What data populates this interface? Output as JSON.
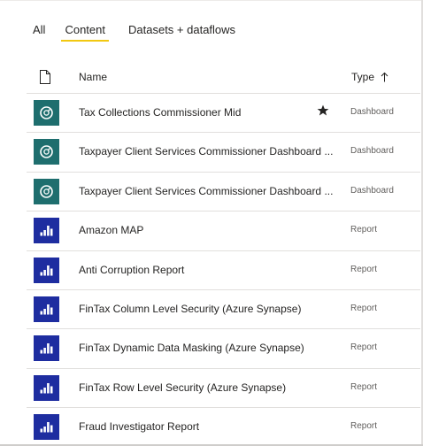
{
  "tabs": [
    {
      "label": "All",
      "active": false
    },
    {
      "label": "Content",
      "active": true
    },
    {
      "label": "Datasets + dataflows",
      "active": false
    }
  ],
  "columns": {
    "file_icon": "file-icon",
    "name": "Name",
    "type": "Type",
    "sort_icon": "arrow-up-icon",
    "sort_direction": "ascending"
  },
  "items": [
    {
      "name": "Tax Collections Commissioner Mid",
      "type": "Dashboard",
      "icon": "dashboard-gauge-icon",
      "favorite": true
    },
    {
      "name": "Taxpayer Client Services Commissioner Dashboard ...",
      "type": "Dashboard",
      "icon": "dashboard-gauge-icon",
      "favorite": false
    },
    {
      "name": "Taxpayer Client Services Commissioner Dashboard ...",
      "type": "Dashboard",
      "icon": "dashboard-gauge-icon",
      "favorite": false
    },
    {
      "name": "Amazon MAP",
      "type": "Report",
      "icon": "report-bar-chart-icon",
      "favorite": false
    },
    {
      "name": "Anti Corruption Report",
      "type": "Report",
      "icon": "report-bar-chart-icon",
      "favorite": false
    },
    {
      "name": "FinTax Column Level Security (Azure Synapse)",
      "type": "Report",
      "icon": "report-bar-chart-icon",
      "favorite": false
    },
    {
      "name": "FinTax Dynamic Data Masking (Azure Synapse)",
      "type": "Report",
      "icon": "report-bar-chart-icon",
      "favorite": false
    },
    {
      "name": "FinTax Row Level Security (Azure Synapse)",
      "type": "Report",
      "icon": "report-bar-chart-icon",
      "favorite": false
    },
    {
      "name": "Fraud Investigator Report",
      "type": "Report",
      "icon": "report-bar-chart-icon",
      "favorite": false
    }
  ],
  "colors": {
    "dashboard_icon_bg": "#1e6e6e",
    "report_icon_bg": "#1e2da0",
    "active_tab_underline": "#f2c811",
    "divider": "#e1dfdd"
  }
}
